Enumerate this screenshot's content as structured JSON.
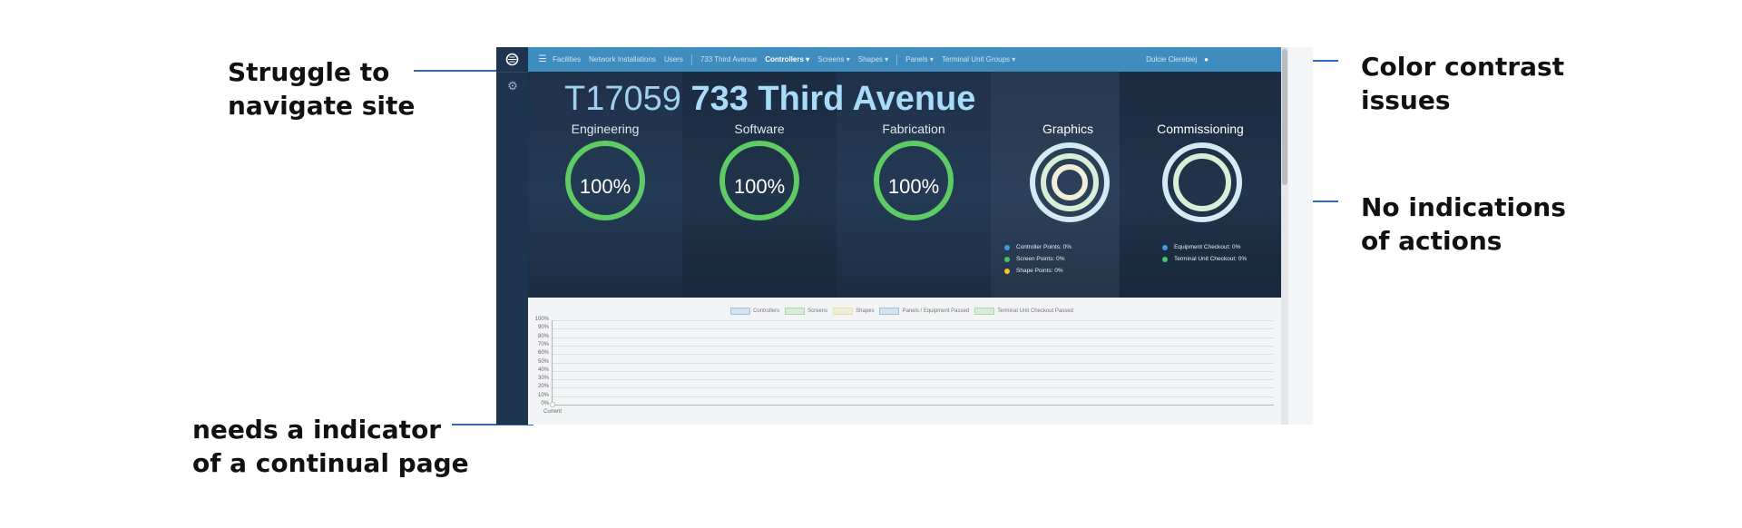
{
  "annotations": {
    "navigate": "Struggle to\nnavigate site",
    "contrast": "Color contrast\nissues",
    "actions": "No indications\nof actions",
    "continual": "needs a indicator\nof a continual page"
  },
  "colors": {
    "accent_line": "#2f68c9",
    "topbar": "#3f8dbf",
    "sidebar": "#1e3550",
    "ring_green": "#5ecb64",
    "dot_blue": "#3f9ad6",
    "dot_green": "#43c56b",
    "dot_yellow": "#f2c12e"
  },
  "sidebar": {
    "logo_icon": "logo-icon",
    "gear_icon": "gear-icon",
    "gear_glyph": "⚙"
  },
  "topbar": {
    "menu_glyph": "☰",
    "items": [
      "Facilities",
      "Network Installations",
      "Users"
    ],
    "site": "733 Third Avenue",
    "dropdowns": [
      "Controllers ▾",
      "Screens ▾",
      "Shapes ▾"
    ],
    "dropdowns2": [
      "Panels ▾",
      "Terminal Unit Groups ▾"
    ],
    "user": "Dulcie Clerebiej",
    "user_icon_glyph": "●"
  },
  "hero": {
    "code": "T17059",
    "name": "733 Third Avenue",
    "metrics": [
      {
        "title": "Engineering",
        "value": "100%",
        "progress": 1.0
      },
      {
        "title": "Software",
        "value": "100%",
        "progress": 1.0
      },
      {
        "title": "Fabrication",
        "value": "100%",
        "progress": 1.0
      }
    ],
    "graphics": {
      "title": "Graphics",
      "legend": [
        "Controller Points: 0%",
        "Screen Points: 0%",
        "Shape Points: 0%"
      ]
    },
    "commissioning": {
      "title": "Commissioning",
      "legend": [
        "Equipment Checkout: 0%",
        "Terminal Unit Checkout: 0%"
      ]
    }
  },
  "chart_data": {
    "type": "line",
    "categories": [
      "Current"
    ],
    "series": [
      {
        "name": "Controllers",
        "values": [
          0
        ],
        "color": "#9cc3e0"
      },
      {
        "name": "Screens",
        "values": [
          0
        ],
        "color": "#a8dba8"
      },
      {
        "name": "Shapes",
        "values": [
          0
        ],
        "color": "#e8e2a2"
      },
      {
        "name": "Panels / Equipment Passed",
        "values": [
          0
        ],
        "color": "#9cc3e0"
      },
      {
        "name": "Terminal Unit Checkout Passed",
        "values": [
          0
        ],
        "color": "#a8dba8"
      }
    ],
    "yticks": [
      "100%",
      "90%",
      "80%",
      "70%",
      "60%",
      "50%",
      "40%",
      "30%",
      "20%",
      "10%",
      "0%"
    ],
    "ylim": [
      0,
      100
    ],
    "grid": true,
    "legend": "top-center"
  }
}
